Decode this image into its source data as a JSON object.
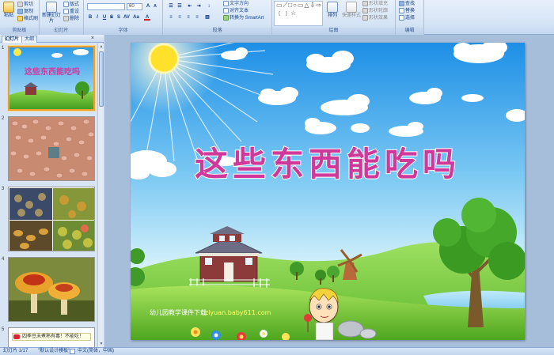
{
  "ribbon": {
    "clipboard": {
      "paste": "粘贴",
      "cut": "剪切",
      "copy": "复制",
      "format_painter": "格式刷",
      "label": "剪贴板"
    },
    "slides": {
      "new_slide": "新建幻灯片",
      "layout": "版式",
      "reset": "重设",
      "delete": "删除",
      "label": "幻灯片"
    },
    "font": {
      "font_name": "",
      "font_size": "60",
      "label": "字体"
    },
    "paragraph": {
      "text_direction": "文字方向",
      "align_text": "对齐文本",
      "smartart": "转换为 SmartArt",
      "label": "段落"
    },
    "drawing": {
      "arrange": "排列",
      "quick_styles": "快速样式",
      "shape_fill": "形状填充",
      "shape_outline": "形状轮廓",
      "shape_effects": "形状效果",
      "label": "绘图",
      "shapes_glyphs": "▭⟋□○▭△⇩⇨⌒⌒﹛﹜☆"
    },
    "editing": {
      "find": "查找",
      "replace": "替换",
      "select": "选择",
      "label": "编辑"
    }
  },
  "pane": {
    "tab_slides": "幻灯片",
    "tab_outline": "大纲",
    "close": "×",
    "thumbnails": [
      {
        "number": "1",
        "title": "这些东西能吃吗"
      },
      {
        "number": "2"
      },
      {
        "number": "3"
      },
      {
        "number": "4"
      },
      {
        "number": "5",
        "caption": "四季豆未煮熟有毒！不能吃！"
      }
    ]
  },
  "slide": {
    "title": "这些东西能吃吗",
    "footer_label": "幼儿园教学课件下载",
    "footer_url": "ziyuan.baby611.com"
  },
  "status": {
    "slide_counter": "幻灯片 1/17",
    "theme": "\"默认设计模板\"",
    "language": "中文(简体，中国)"
  },
  "colors": {
    "ribbon_bg": "#dbe8f7",
    "title_color": "#d0399a",
    "selected_border": "#f0a030"
  }
}
